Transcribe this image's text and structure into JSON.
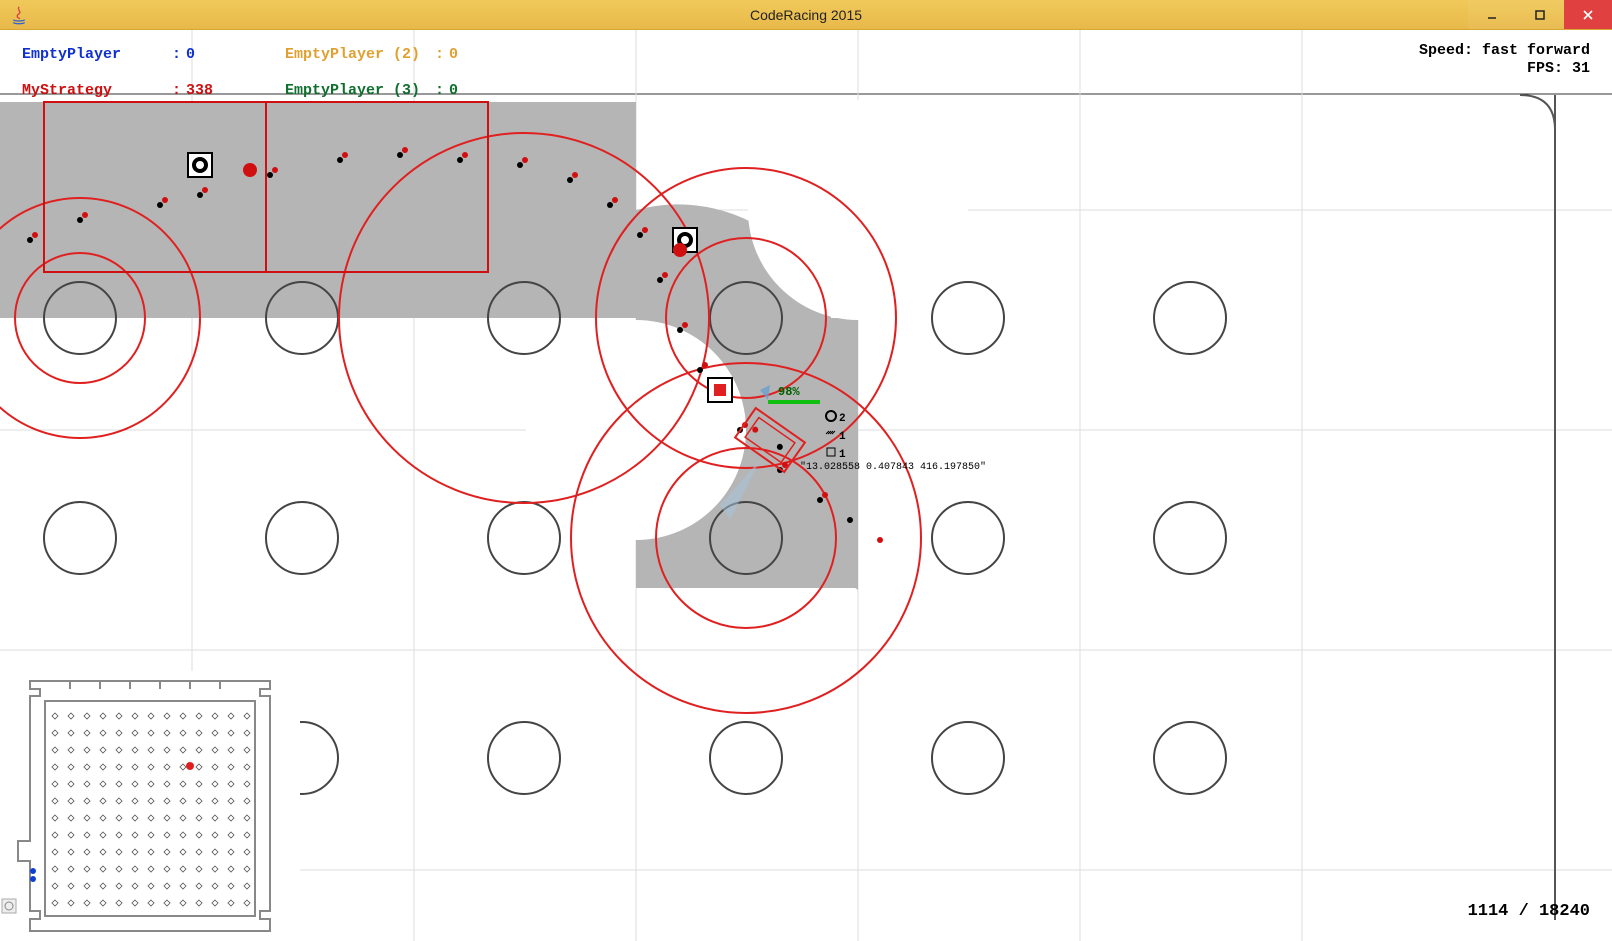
{
  "window": {
    "title": "CodeRacing 2015"
  },
  "players": [
    {
      "name": "EmptyPlayer",
      "score": 0,
      "col": 1,
      "row": 1,
      "cls": "p-blue"
    },
    {
      "name": "MyStrategy",
      "score": 338,
      "col": 1,
      "row": 2,
      "cls": "p-red"
    },
    {
      "name": "EmptyPlayer (2)",
      "score": 0,
      "col": 2,
      "row": 1,
      "cls": "p-orange"
    },
    {
      "name": "EmptyPlayer (3)",
      "score": 0,
      "col": 2,
      "row": 2,
      "cls": "p-green"
    }
  ],
  "hud": {
    "speed_label": "Speed:",
    "speed_value": "fast forward",
    "fps_label": "FPS:",
    "fps_value": 31,
    "frame_current": 1114,
    "frame_total": 18240
  },
  "car": {
    "health_pct": "98%",
    "debug_text": "\"13.028558 0.407843 416.197850\"",
    "tire_count": 2,
    "nitro_count": 1,
    "oil_count": 1
  }
}
